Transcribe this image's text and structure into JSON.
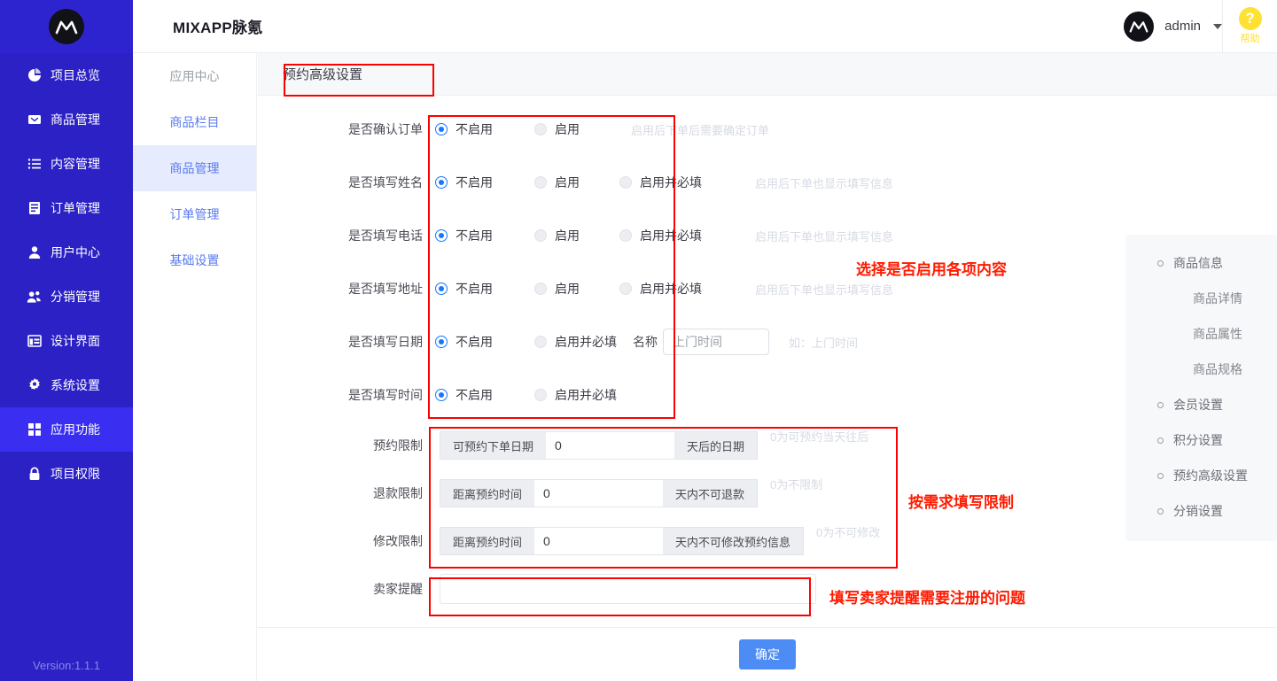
{
  "app": {
    "brand": "MIXAPP脉氪",
    "version": "Version:1.1.1",
    "logo_alt": "mixapp-logo"
  },
  "header": {
    "username": "admin",
    "help_mark": "?",
    "help_label": "帮助"
  },
  "sidebar": {
    "items": [
      {
        "label": "项目总览",
        "icon": "pie-chart-icon",
        "active": false
      },
      {
        "label": "商品管理",
        "icon": "inbox-icon",
        "active": false
      },
      {
        "label": "内容管理",
        "icon": "list-icon",
        "active": false
      },
      {
        "label": "订单管理",
        "icon": "document-icon",
        "active": false
      },
      {
        "label": "用户中心",
        "icon": "user-icon",
        "active": false
      },
      {
        "label": "分销管理",
        "icon": "users-icon",
        "active": false
      },
      {
        "label": "设计界面",
        "icon": "layout-icon",
        "active": false
      },
      {
        "label": "系统设置",
        "icon": "gear-icon",
        "active": false
      },
      {
        "label": "应用功能",
        "icon": "grid-icon",
        "active": true
      },
      {
        "label": "项目权限",
        "icon": "lock-icon",
        "active": false
      }
    ]
  },
  "subnav": {
    "items": [
      {
        "label": "应用中心",
        "state": "muted"
      },
      {
        "label": "商品栏目",
        "state": "normal"
      },
      {
        "label": "商品管理",
        "state": "active"
      },
      {
        "label": "订单管理",
        "state": "normal"
      },
      {
        "label": "基础设置",
        "state": "normal"
      }
    ]
  },
  "card": {
    "title": "预约高级设置",
    "submit_label": "确定"
  },
  "form": {
    "radio_rows": [
      {
        "label": "是否确认订单",
        "options": [
          {
            "text": "不启用",
            "checked": true
          },
          {
            "text": "启用",
            "checked": false
          }
        ],
        "hint": "启用后下单后需要确定订单"
      },
      {
        "label": "是否填写姓名",
        "options": [
          {
            "text": "不启用",
            "checked": true
          },
          {
            "text": "启用",
            "checked": false
          },
          {
            "text": "启用并必填",
            "checked": false
          }
        ],
        "hint": "启用后下单也显示填写信息"
      },
      {
        "label": "是否填写电话",
        "options": [
          {
            "text": "不启用",
            "checked": true
          },
          {
            "text": "启用",
            "checked": false
          },
          {
            "text": "启用并必填",
            "checked": false
          }
        ],
        "hint": "启用后下单也显示填写信息"
      },
      {
        "label": "是否填写地址",
        "options": [
          {
            "text": "不启用",
            "checked": true
          },
          {
            "text": "启用",
            "checked": false
          },
          {
            "text": "启用并必填",
            "checked": false
          }
        ],
        "hint": "启用后下单也显示填写信息"
      }
    ],
    "date_row": {
      "label": "是否填写日期",
      "options": [
        {
          "text": "不启用",
          "checked": true
        },
        {
          "text": "启用并必填",
          "checked": false
        }
      ],
      "name_label": "名称",
      "name_placeholder": "上门时间",
      "name_value": "",
      "hint": "如：上门时间"
    },
    "time_row": {
      "label": "是否填写时间",
      "options": [
        {
          "text": "不启用",
          "checked": true
        },
        {
          "text": "启用并必填",
          "checked": false
        }
      ]
    },
    "limit_rows": [
      {
        "label": "预约限制",
        "prefix": "可预约下单日期",
        "value": "0",
        "suffix": "天后的日期",
        "hint": "0为可预约当天往后"
      },
      {
        "label": "退款限制",
        "prefix": "距离预约时间",
        "value": "0",
        "suffix": "天内不可退款",
        "hint": "0为不限制"
      },
      {
        "label": "修改限制",
        "prefix": "距离预约时间",
        "value": "0",
        "suffix": "天内不可修改预约信息",
        "hint": "0为不可修改"
      }
    ],
    "seller_row": {
      "label": "卖家提醒",
      "value": "",
      "placeholder": ""
    }
  },
  "quicknav": {
    "items": [
      {
        "label": "商品信息",
        "sub": false
      },
      {
        "label": "商品详情",
        "sub": true
      },
      {
        "label": "商品属性",
        "sub": true
      },
      {
        "label": "商品规格",
        "sub": true
      },
      {
        "label": "会员设置",
        "sub": false
      },
      {
        "label": "积分设置",
        "sub": false
      },
      {
        "label": "预约高级设置",
        "sub": false
      },
      {
        "label": "分销设置",
        "sub": false
      }
    ]
  },
  "annotations": [
    {
      "text": "选择是否启用各项内容"
    },
    {
      "text": "按需求填写限制"
    },
    {
      "text": "填写卖家提醒需要注册的问题"
    }
  ],
  "colors": {
    "sidebar": "#2b21c4",
    "sidebar_active": "#3a2ff0",
    "accent": "#1677ff",
    "primary_btn": "#4d8cf5",
    "annotation": "#ff1a00",
    "help_yellow": "#ffe133"
  }
}
